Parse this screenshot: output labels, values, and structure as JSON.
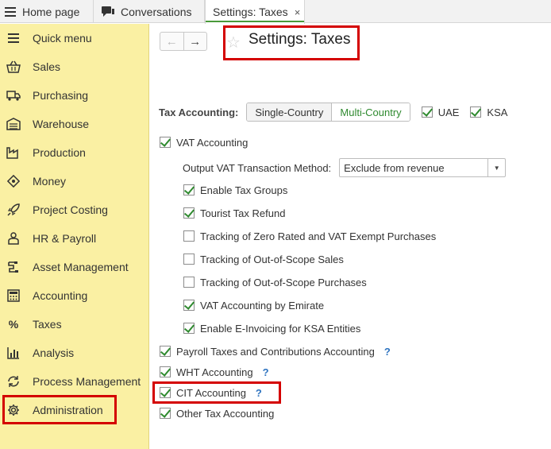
{
  "tabs": {
    "home": "Home page",
    "conversations": "Conversations",
    "settings": "Settings: Taxes",
    "close": "×"
  },
  "sidebar": {
    "items": [
      {
        "label": "Quick menu",
        "icon": "menu-icon"
      },
      {
        "label": "Sales",
        "icon": "basket-icon"
      },
      {
        "label": "Purchasing",
        "icon": "truck-icon"
      },
      {
        "label": "Warehouse",
        "icon": "warehouse-icon"
      },
      {
        "label": "Production",
        "icon": "factory-icon"
      },
      {
        "label": "Money",
        "icon": "money-icon"
      },
      {
        "label": "Project Costing",
        "icon": "rocket-icon"
      },
      {
        "label": "HR & Payroll",
        "icon": "person-icon"
      },
      {
        "label": "Asset Management",
        "icon": "asset-icon"
      },
      {
        "label": "Accounting",
        "icon": "calculator-icon"
      },
      {
        "label": "Taxes",
        "icon": "percent-icon"
      },
      {
        "label": "Analysis",
        "icon": "chart-icon"
      },
      {
        "label": "Process Management",
        "icon": "process-icon"
      },
      {
        "label": "Administration",
        "icon": "gear-icon"
      }
    ]
  },
  "page": {
    "title": "Settings: Taxes"
  },
  "tax_accounting": {
    "label": "Tax Accounting:",
    "single": "Single-Country",
    "multi": "Multi-Country",
    "uae": "UAE",
    "ksa": "KSA"
  },
  "vat": {
    "label": "VAT Accounting",
    "method_label": "Output VAT Transaction Method:",
    "method_value": "Exclude from revenue",
    "options": [
      {
        "label": "Enable Tax Groups",
        "checked": true
      },
      {
        "label": "Tourist Tax Refund",
        "checked": true
      },
      {
        "label": "Tracking of Zero Rated and VAT Exempt Purchases",
        "checked": false
      },
      {
        "label": "Tracking of Out-of-Scope Sales",
        "checked": false
      },
      {
        "label": "Tracking of Out-of-Scope Purchases",
        "checked": false
      },
      {
        "label": "VAT Accounting by Emirate",
        "checked": true
      },
      {
        "label": "Enable E-Invoicing for KSA Entities",
        "checked": true
      }
    ]
  },
  "other": {
    "payroll": "Payroll Taxes and Contributions Accounting",
    "wht": "WHT Accounting",
    "cit": "CIT Accounting",
    "other_tax": "Other Tax Accounting",
    "help": "?"
  }
}
